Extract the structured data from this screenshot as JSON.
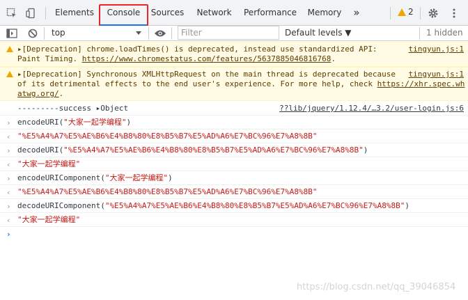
{
  "tabs": [
    {
      "label": "Elements"
    },
    {
      "label": "Console"
    },
    {
      "label": "Sources"
    },
    {
      "label": "Network"
    },
    {
      "label": "Performance"
    },
    {
      "label": "Memory"
    }
  ],
  "more_tabs": "»",
  "warning_count": "2",
  "toolbar": {
    "context": "top",
    "filter_placeholder": "Filter",
    "levels": "Default levels ▼",
    "hidden": "1 hidden"
  },
  "messages": [
    {
      "line1": "▸[Deprecation] chrome.loadTimes() is deprecated, instead use standardized API:",
      "line2_pre": "Paint Timing. ",
      "line2_link": "https://www.chromestatus.com/features/5637885046816768",
      "line2_post": ".",
      "source": "tingyun.js:1"
    },
    {
      "line1": "▸[Deprecation] Synchronous XMLHttpRequest on the main thread is deprecated because",
      "line2_pre": "of its detrimental effects to the end user's experience. For more help, check ",
      "line2_link": "https://xhr.spec.wh",
      "line3_link": "atwg.org/",
      "line3_post": ".",
      "source": "tingyun.js:1"
    }
  ],
  "log": {
    "text": "---------success ▸Object",
    "source": "??lib/jquery/1.12.4/…3.2/user-login.js:6"
  },
  "entries": [
    {
      "input_fn": "encodeURI(",
      "input_arg": "\"大家一起学编程\"",
      "input_end": ")",
      "output": "\"%E5%A4%A7%E5%AE%B6%E4%B8%80%E8%B5%B7%E5%AD%A6%E7%BC%96%E7%A8%8B\""
    },
    {
      "input_fn": "decodeURI(",
      "input_arg": "\"%E5%A4%A7%E5%AE%B6%E4%B8%80%E8%B5%B7%E5%AD%A6%E7%BC%96%E7%A8%8B\"",
      "input_end": ")",
      "output": "\"大家一起学编程\""
    },
    {
      "input_fn": "encodeURIComponent(",
      "input_arg": "\"大家一起学编程\"",
      "input_end": ")",
      "output": "\"%E5%A4%A7%E5%AE%B6%E4%B8%80%E8%B5%B7%E5%AD%A6%E7%BC%96%E7%A8%8B\""
    },
    {
      "input_fn": "decodeURIComponent(",
      "input_arg": "\"%E5%A4%A7%E5%AE%B6%E4%B8%80%E8%B5%B7%E5%AD%A6%E7%BC%96%E7%A8%8B\"",
      "input_end": ")",
      "output": "\"大家一起学编程\""
    }
  ],
  "prompt_symbol": "›",
  "watermark": "https://blog.csdn.net/qq_39046854",
  "colors": {
    "accent": "#1a73e8",
    "highlight": "#e8262b",
    "string": "#c41a16",
    "warning_bg": "#fffbe5"
  }
}
